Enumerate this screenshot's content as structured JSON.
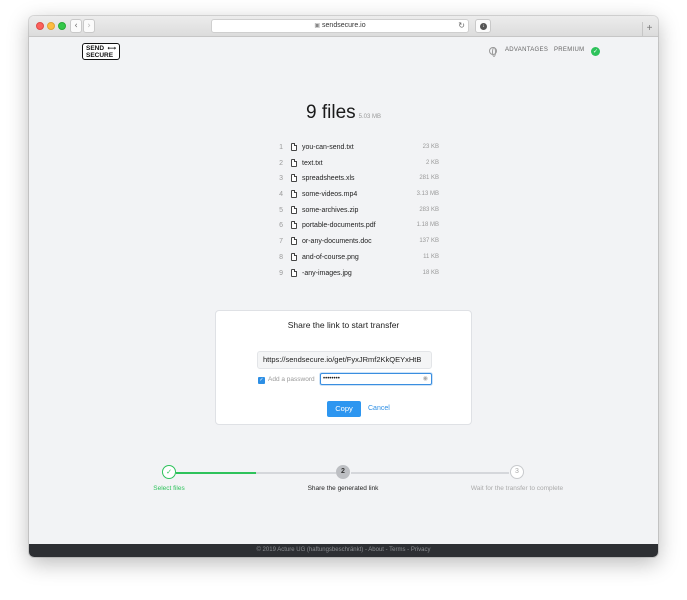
{
  "browser": {
    "url": "sendsecure.io"
  },
  "header": {
    "logo_line1": "SEND",
    "logo_line2": "SECURE",
    "nav": {
      "advantages": "ADVANTAGES",
      "premium": "PREMIUM"
    }
  },
  "summary": {
    "count": "9 files",
    "size": "5.03 MB"
  },
  "files": [
    {
      "num": "1",
      "name": "you-can-send.txt",
      "size": "23 KB"
    },
    {
      "num": "2",
      "name": "text.txt",
      "size": "2 KB"
    },
    {
      "num": "3",
      "name": "spreadsheets.xls",
      "size": "281 KB"
    },
    {
      "num": "4",
      "name": "some-videos.mp4",
      "size": "3.13 MB"
    },
    {
      "num": "5",
      "name": "some-archives.zip",
      "size": "283 KB"
    },
    {
      "num": "6",
      "name": "portable-documents.pdf",
      "size": "1.18 MB"
    },
    {
      "num": "7",
      "name": "or-any-documents.doc",
      "size": "137 KB"
    },
    {
      "num": "8",
      "name": "and-of-course.png",
      "size": "11 KB"
    },
    {
      "num": "9",
      "name": "-any-images.jpg",
      "size": "18 KB"
    }
  ],
  "share": {
    "title": "Share the link to start transfer",
    "link": "https://sendsecure.io/get/FyxJRmf2KkQEYxHtB",
    "password_checkbox_label": "Add a password",
    "password_value": "••••••••",
    "copy_label": "Copy",
    "cancel_label": "Cancel"
  },
  "steps": [
    {
      "number": "1",
      "label": "Select files",
      "state": "done"
    },
    {
      "number": "2",
      "label": "Share the generated link",
      "state": "active"
    },
    {
      "number": "3",
      "label": "Wait for the transfer to complete",
      "state": "pending"
    }
  ],
  "footer": {
    "text": "© 2019 Acture UG (haftungsbeschränkt) - About - Terms - Privacy"
  },
  "colors": {
    "accent_green": "#2ec25b",
    "accent_blue": "#2d96f0",
    "footer_bg": "#2d2f33"
  }
}
